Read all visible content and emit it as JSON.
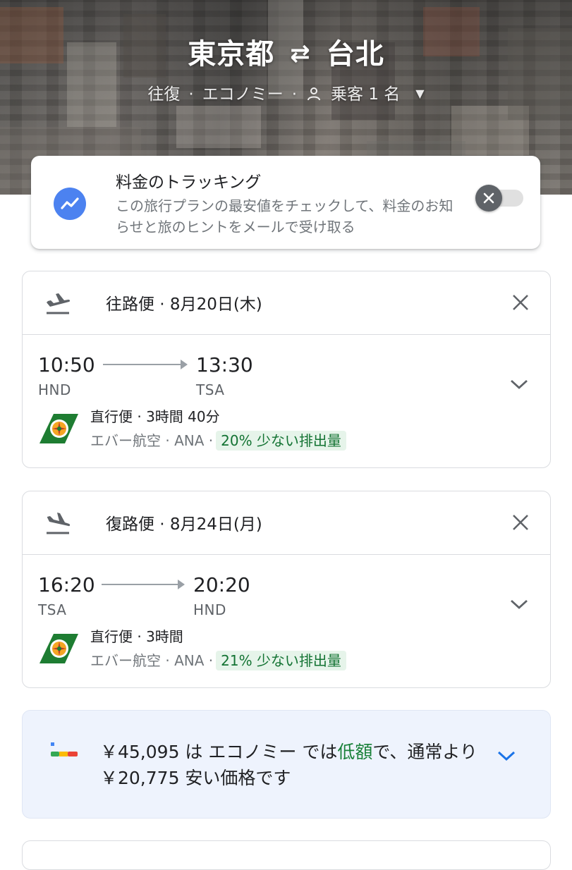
{
  "header": {
    "origin": "東京都",
    "swap_icon": "swap-arrows-icon",
    "destination": "台北",
    "trip_type": "往復",
    "cabin": "エコノミー",
    "separator": "·",
    "passengers": "乗客 1 名"
  },
  "tracking": {
    "title": "料金のトラッキング",
    "description": "この旅行プランの最安値をチェックして、料金のお知らせと旅のヒントをメールで受け取る",
    "enabled": false
  },
  "flights": [
    {
      "title": "往路便 · 8月20日(木)",
      "dep_time": "10:50",
      "dep_airport": "HND",
      "arr_time": "13:30",
      "arr_airport": "TSA",
      "duration": "直行便 · 3時間 40分",
      "airlines": "エバー航空 · ANA ·",
      "emissions": "20% 少ない排出量"
    },
    {
      "title": "復路便 · 8月24日(月)",
      "dep_time": "16:20",
      "dep_airport": "TSA",
      "arr_time": "20:20",
      "arr_airport": "HND",
      "duration": "直行便 · 3時間",
      "airlines": "エバー航空 · ANA ·",
      "emissions": "21% 少ない排出量"
    }
  ],
  "price_insight": {
    "before": "￥45,095 は エコノミー では",
    "highlight": "低額",
    "after": "で、通常より ￥20,775 安い価格です"
  },
  "colors": {
    "accent_blue": "#4c82f0",
    "emission_green": "#137333",
    "emission_bg": "#e6f4ea",
    "price_bg": "#eef3fd",
    "low_price_green": "#188038"
  }
}
